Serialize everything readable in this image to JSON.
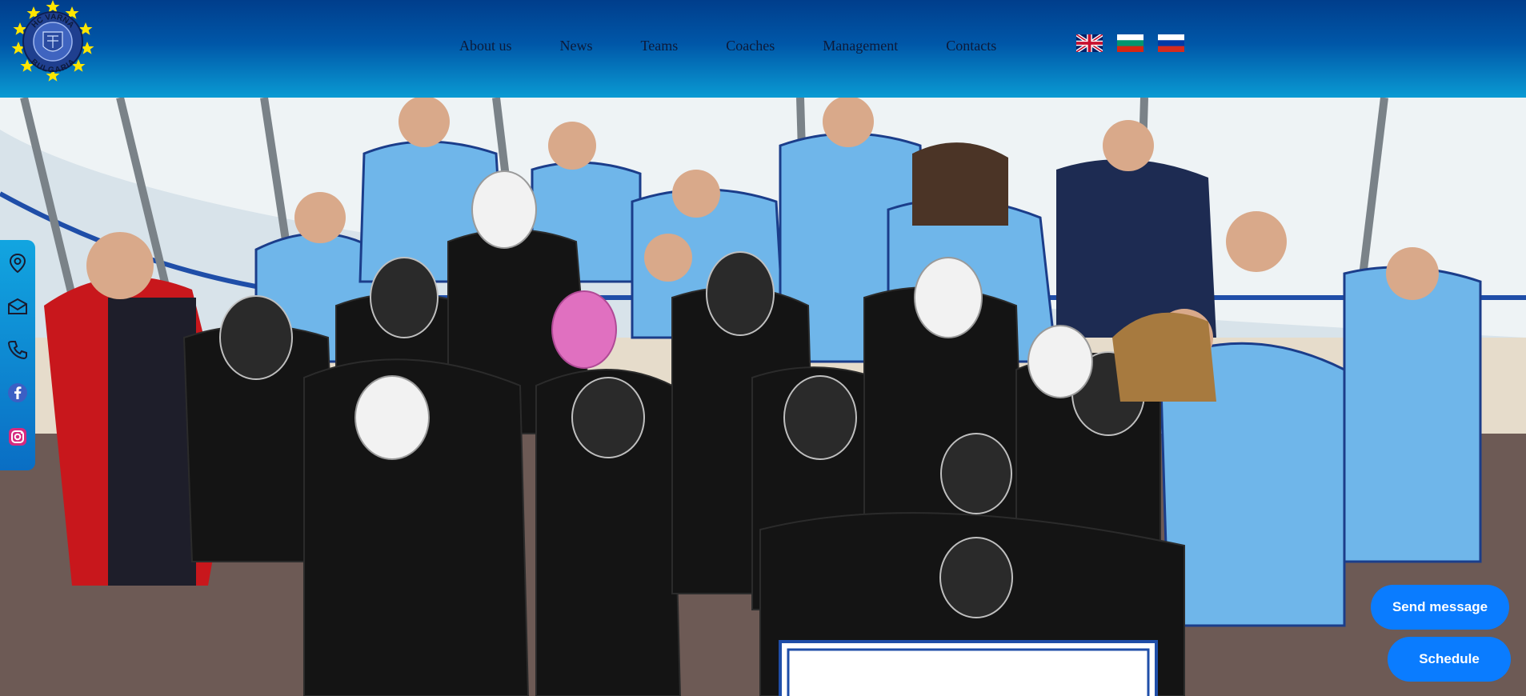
{
  "header": {
    "logo": {
      "top_text": "HC VARNA",
      "bottom_text": "BULGARIA",
      "colors": {
        "star": "#ffe600",
        "ring": "#1f3f8f",
        "inner": "#3f64c0"
      }
    },
    "nav": {
      "items": [
        {
          "label": "About us"
        },
        {
          "label": "News"
        },
        {
          "label": "Teams"
        },
        {
          "label": "Coaches"
        },
        {
          "label": "Management"
        },
        {
          "label": "Contacts"
        }
      ]
    },
    "languages": [
      {
        "code": "en",
        "icon": "uk-flag-icon"
      },
      {
        "code": "bg",
        "icon": "bulgaria-flag-icon"
      },
      {
        "code": "ru",
        "icon": "russia-flag-icon"
      }
    ]
  },
  "hero": {
    "description_icon": "team-photo",
    "colors": {
      "team_light": "#6fb6ea",
      "team_dark": "#121212",
      "rink_glass": "#eef3f5"
    }
  },
  "social": {
    "items": [
      {
        "icon": "location-pin-icon"
      },
      {
        "icon": "envelope-icon"
      },
      {
        "icon": "phone-icon"
      },
      {
        "icon": "facebook-icon"
      },
      {
        "icon": "instagram-icon"
      }
    ]
  },
  "actions": {
    "send_message": "Send message",
    "schedule": "Schedule"
  },
  "colors": {
    "header_top": "#003e8c",
    "header_bottom": "#0a9ad3",
    "button": "#0a7cff",
    "social_bar": "#0f8fd8"
  }
}
